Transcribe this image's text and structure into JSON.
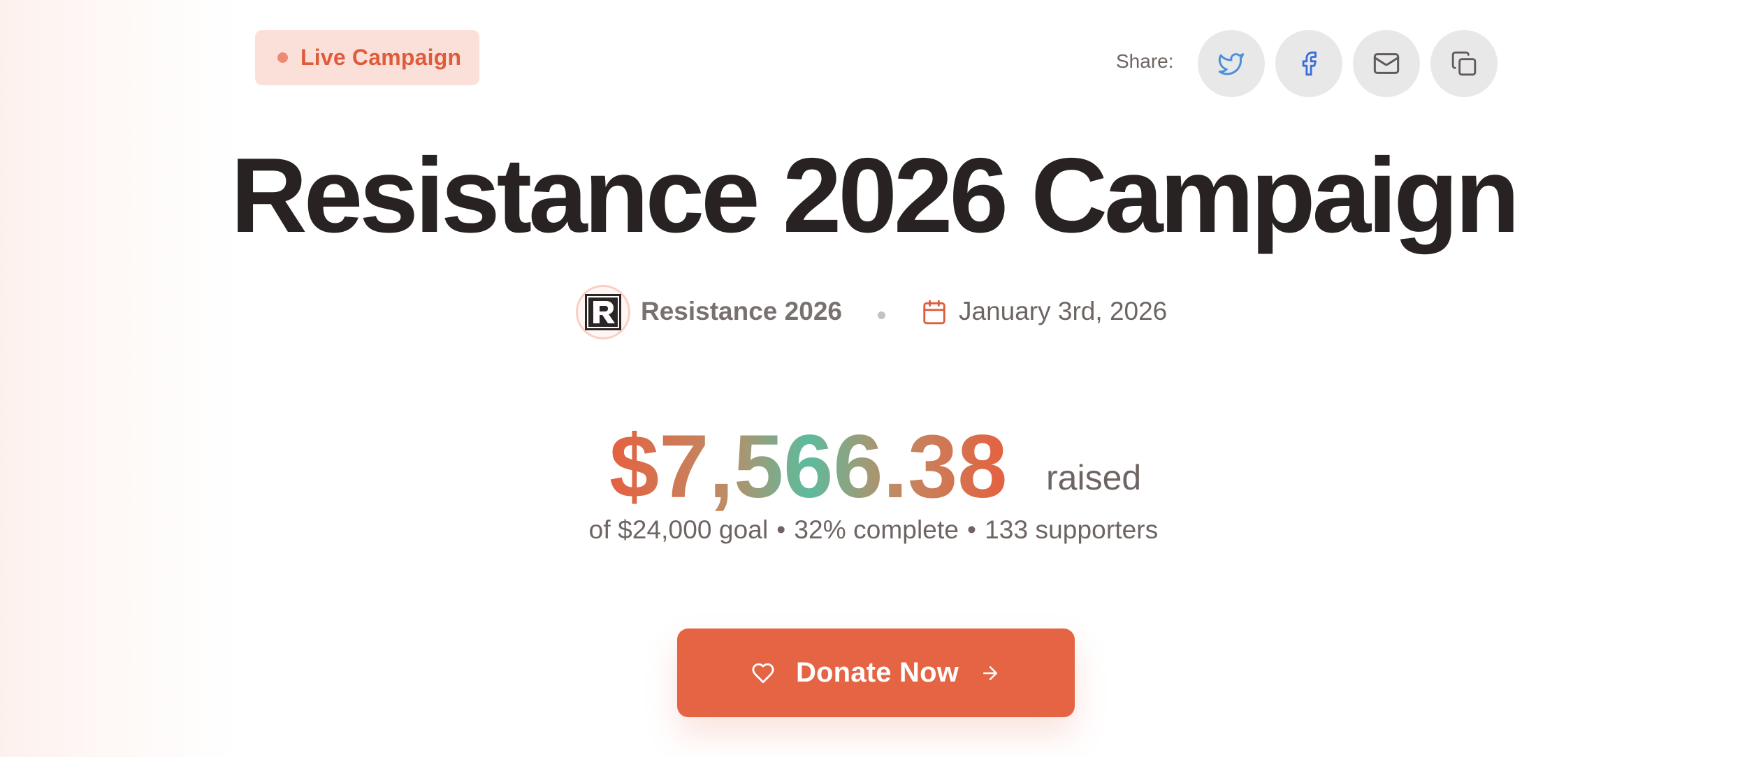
{
  "badge": {
    "label": "Live Campaign"
  },
  "share": {
    "label": "Share:",
    "buttons": [
      {
        "icon": "twitter-icon",
        "color": "#4a90d9"
      },
      {
        "icon": "facebook-icon",
        "color": "#3b6fd8"
      },
      {
        "icon": "mail-icon",
        "color": "#5f5a59"
      },
      {
        "icon": "copy-icon",
        "color": "#5f5a59"
      }
    ]
  },
  "campaign": {
    "title": "Resistance 2026 Campaign",
    "organizer": "Resistance 2026",
    "date": "January 3rd, 2026"
  },
  "funding": {
    "amount_raised": "$7,566.38",
    "raised_word": "raised",
    "goal_text": "of $24,000 goal",
    "percent_text": "32% complete",
    "supporters_text": "133 supporters",
    "separator": "•"
  },
  "donate": {
    "label": "Donate Now"
  },
  "colors": {
    "accent": "#e56443",
    "badge_bg": "#fbe0d9",
    "badge_text": "#e05b3b",
    "gradient_mid": "#5dbb9e",
    "title": "#282322",
    "muted": "#6e6563"
  }
}
